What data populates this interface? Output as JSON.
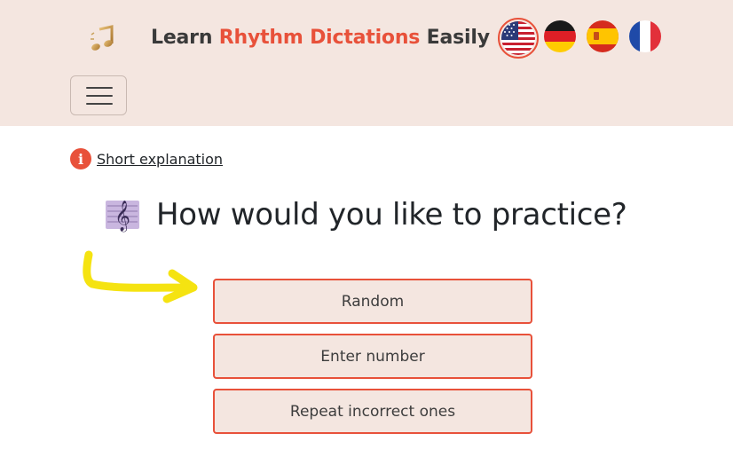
{
  "header": {
    "logo_icon": "music-notes-icon",
    "title_part1": "Learn ",
    "title_accent": "Rhythm Dictations",
    "title_part2": " Easily",
    "accent_color": "#e8513a",
    "background_color": "#f4e6e0",
    "languages": [
      {
        "flag": "us-flag-icon",
        "selected": true
      },
      {
        "flag": "germany-flag-icon",
        "selected": false
      },
      {
        "flag": "spain-flag-icon",
        "selected": false
      },
      {
        "flag": "france-flag-icon",
        "selected": false
      }
    ],
    "menu_icon": "hamburger-menu-icon"
  },
  "main": {
    "info_icon": "info-icon",
    "info_link": "Short explanation",
    "heading_icon": "treble-clef-icon",
    "heading": "How would you like to practice?",
    "pointer_icon": "yellow-arrow-icon",
    "options": [
      {
        "label": "Random"
      },
      {
        "label": "Enter number"
      },
      {
        "label": "Repeat incorrect ones"
      }
    ]
  }
}
